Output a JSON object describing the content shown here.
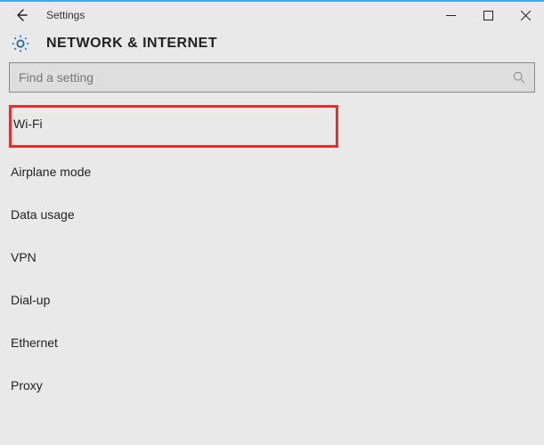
{
  "window": {
    "title": "Settings"
  },
  "page": {
    "heading": "NETWORK & INTERNET"
  },
  "search": {
    "placeholder": "Find a setting"
  },
  "nav": {
    "items": [
      "Wi-Fi",
      "Airplane mode",
      "Data usage",
      "VPN",
      "Dial-up",
      "Ethernet",
      "Proxy"
    ]
  }
}
